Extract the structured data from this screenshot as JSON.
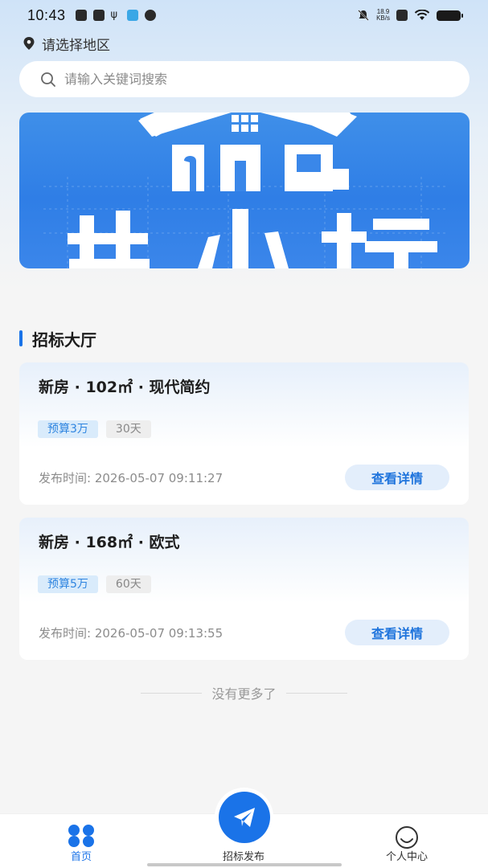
{
  "status_bar": {
    "time": "10:43",
    "net_speed_value": "18.9",
    "net_speed_unit": "KB/s"
  },
  "location": {
    "label": "请选择地区"
  },
  "search": {
    "placeholder": "请输入关键词搜索"
  },
  "banner": {
    "text": "装小标"
  },
  "section": {
    "title": "招标大厅"
  },
  "listings": [
    {
      "title": "新房 · 102㎡ · 现代简约",
      "budget": "预算3万",
      "duration": "30天",
      "time": "发布时间: 2026-05-07 09:11:27",
      "button": "查看详情"
    },
    {
      "title": "新房 · 168㎡ · 欧式",
      "budget": "预算5万",
      "duration": "60天",
      "time": "发布时间: 2026-05-07 09:13:55",
      "button": "查看详情"
    }
  ],
  "list_end": "没有更多了",
  "tabbar": {
    "home": "首页",
    "post": "招标发布",
    "profile": "个人中心"
  },
  "colors": {
    "primary": "#1a73e8",
    "banner": "#3a87e9",
    "budget_tag_bg": "#d9ebfb",
    "button_bg": "#e3eefb"
  },
  "icons": {
    "location": "location-pin-icon",
    "search": "search-icon",
    "home_tab": "four-circles-icon",
    "post_tab": "paper-plane-icon",
    "profile_tab": "smiley-face-icon"
  }
}
